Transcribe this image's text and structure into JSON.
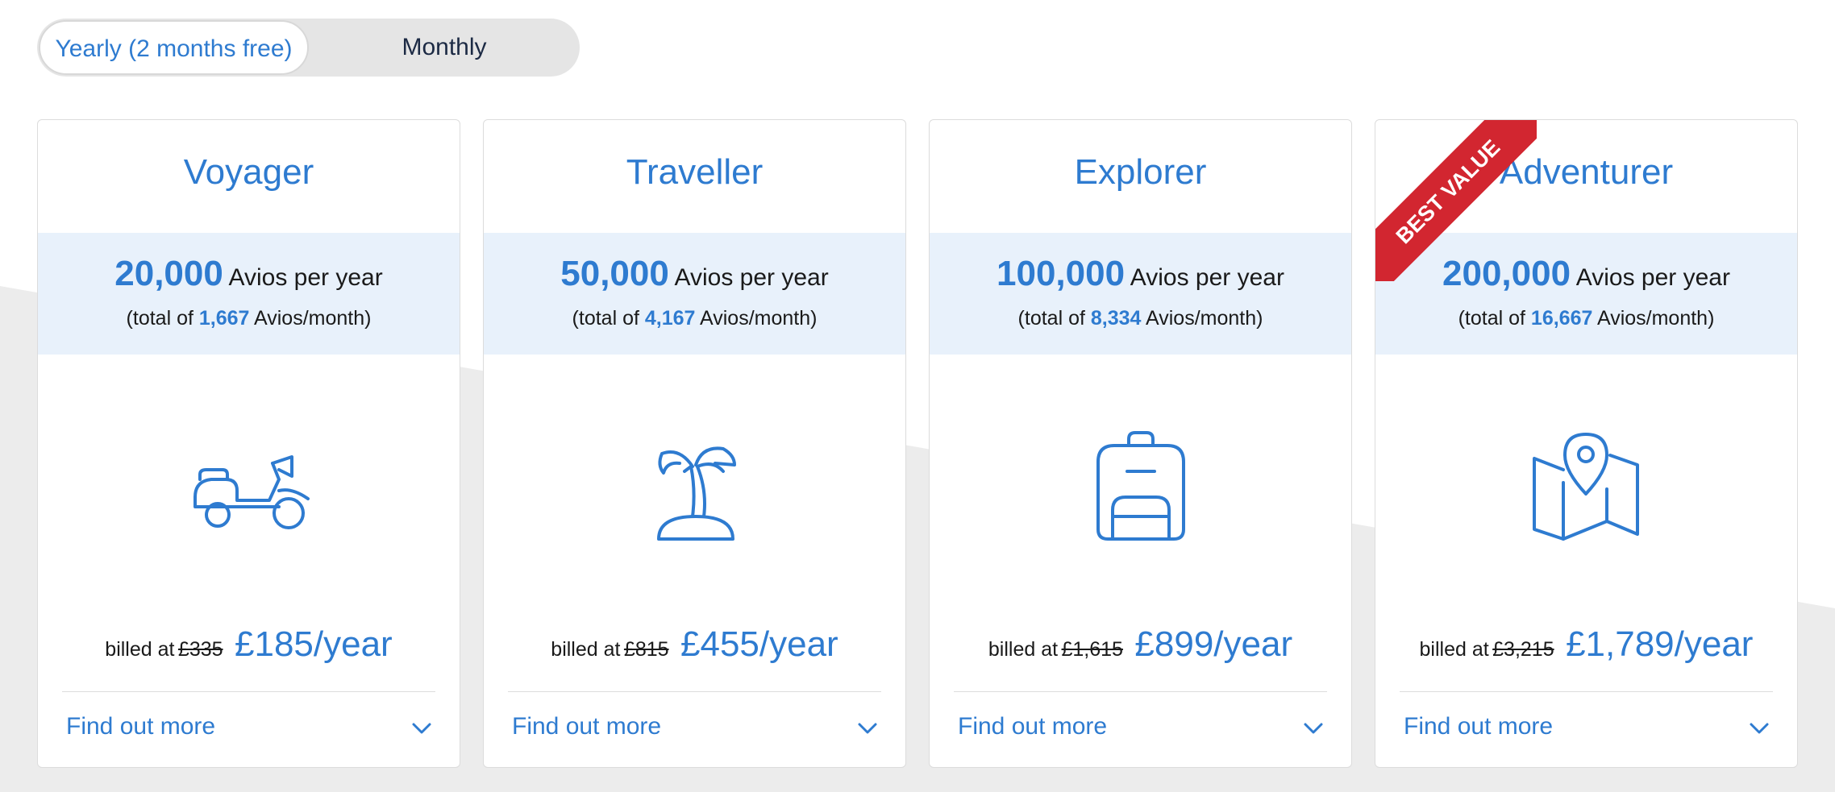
{
  "toggle": {
    "yearly_label": "Yearly (2 months free)",
    "monthly_label": "Monthly"
  },
  "colors": {
    "accent": "#2e7bd0",
    "band": "#e8f1fb",
    "ribbon": "#d22630"
  },
  "plans": [
    {
      "name": "Voyager",
      "avios_per_year": "20,000",
      "avios_unit": "Avios per year",
      "total_prefix": "(total of",
      "avios_per_month": "1,667",
      "month_suffix": "Avios/month)",
      "icon": "scooter-icon",
      "billed_label": "billed at",
      "old_price": "£335",
      "price": "£185/year",
      "find_more": "Find out more"
    },
    {
      "name": "Traveller",
      "avios_per_year": "50,000",
      "avios_unit": "Avios per year",
      "total_prefix": "(total of",
      "avios_per_month": "4,167",
      "month_suffix": "Avios/month)",
      "icon": "palm-island-icon",
      "billed_label": "billed at",
      "old_price": "£815",
      "price": "£455/year",
      "find_more": "Find out more"
    },
    {
      "name": "Explorer",
      "avios_per_year": "100,000",
      "avios_unit": "Avios per year",
      "total_prefix": "(total of",
      "avios_per_month": "8,334",
      "month_suffix": "Avios/month)",
      "icon": "backpack-icon",
      "billed_label": "billed at",
      "old_price": "£1,615",
      "price": "£899/year",
      "find_more": "Find out more"
    },
    {
      "name": "Adventurer",
      "badge": "BEST VALUE",
      "avios_per_year": "200,000",
      "avios_unit": "Avios per year",
      "total_prefix": "(total of",
      "avios_per_month": "16,667",
      "month_suffix": "Avios/month)",
      "icon": "map-pin-icon",
      "billed_label": "billed at",
      "old_price": "£3,215",
      "price": "£1,789/year",
      "find_more": "Find out more"
    }
  ]
}
